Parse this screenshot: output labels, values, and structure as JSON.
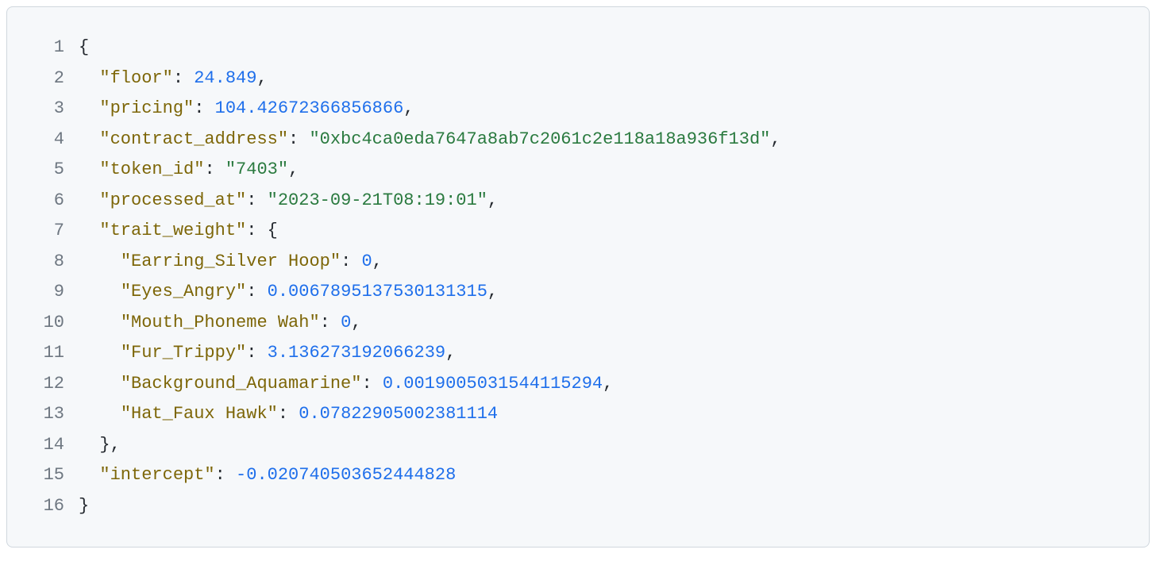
{
  "lines": [
    {
      "num": "1",
      "tokens": [
        {
          "t": "{",
          "c": "punct"
        }
      ]
    },
    {
      "num": "2",
      "tokens": [
        {
          "t": "  ",
          "c": "punct"
        },
        {
          "t": "\"floor\"",
          "c": "key"
        },
        {
          "t": ": ",
          "c": "punct"
        },
        {
          "t": "24.849",
          "c": "number"
        },
        {
          "t": ",",
          "c": "punct"
        }
      ]
    },
    {
      "num": "3",
      "tokens": [
        {
          "t": "  ",
          "c": "punct"
        },
        {
          "t": "\"pricing\"",
          "c": "key"
        },
        {
          "t": ": ",
          "c": "punct"
        },
        {
          "t": "104.42672366856866",
          "c": "number"
        },
        {
          "t": ",",
          "c": "punct"
        }
      ]
    },
    {
      "num": "4",
      "tokens": [
        {
          "t": "  ",
          "c": "punct"
        },
        {
          "t": "\"contract_address\"",
          "c": "key"
        },
        {
          "t": ": ",
          "c": "punct"
        },
        {
          "t": "\"0xbc4ca0eda7647a8ab7c2061c2e118a18a936f13d\"",
          "c": "string"
        },
        {
          "t": ",",
          "c": "punct"
        }
      ]
    },
    {
      "num": "5",
      "tokens": [
        {
          "t": "  ",
          "c": "punct"
        },
        {
          "t": "\"token_id\"",
          "c": "key"
        },
        {
          "t": ": ",
          "c": "punct"
        },
        {
          "t": "\"7403\"",
          "c": "string"
        },
        {
          "t": ",",
          "c": "punct"
        }
      ]
    },
    {
      "num": "6",
      "tokens": [
        {
          "t": "  ",
          "c": "punct"
        },
        {
          "t": "\"processed_at\"",
          "c": "key"
        },
        {
          "t": ": ",
          "c": "punct"
        },
        {
          "t": "\"2023-09-21T08:19:01\"",
          "c": "string"
        },
        {
          "t": ",",
          "c": "punct"
        }
      ]
    },
    {
      "num": "7",
      "tokens": [
        {
          "t": "  ",
          "c": "punct"
        },
        {
          "t": "\"trait_weight\"",
          "c": "key"
        },
        {
          "t": ": {",
          "c": "punct"
        }
      ]
    },
    {
      "num": "8",
      "tokens": [
        {
          "t": "    ",
          "c": "punct"
        },
        {
          "t": "\"Earring_Silver Hoop\"",
          "c": "key"
        },
        {
          "t": ": ",
          "c": "punct"
        },
        {
          "t": "0",
          "c": "number"
        },
        {
          "t": ",",
          "c": "punct"
        }
      ]
    },
    {
      "num": "9",
      "tokens": [
        {
          "t": "    ",
          "c": "punct"
        },
        {
          "t": "\"Eyes_Angry\"",
          "c": "key"
        },
        {
          "t": ": ",
          "c": "punct"
        },
        {
          "t": "0.0067895137530131315",
          "c": "number"
        },
        {
          "t": ",",
          "c": "punct"
        }
      ]
    },
    {
      "num": "10",
      "tokens": [
        {
          "t": "    ",
          "c": "punct"
        },
        {
          "t": "\"Mouth_Phoneme Wah\"",
          "c": "key"
        },
        {
          "t": ": ",
          "c": "punct"
        },
        {
          "t": "0",
          "c": "number"
        },
        {
          "t": ",",
          "c": "punct"
        }
      ]
    },
    {
      "num": "11",
      "tokens": [
        {
          "t": "    ",
          "c": "punct"
        },
        {
          "t": "\"Fur_Trippy\"",
          "c": "key"
        },
        {
          "t": ": ",
          "c": "punct"
        },
        {
          "t": "3.136273192066239",
          "c": "number"
        },
        {
          "t": ",",
          "c": "punct"
        }
      ]
    },
    {
      "num": "12",
      "tokens": [
        {
          "t": "    ",
          "c": "punct"
        },
        {
          "t": "\"Background_Aquamarine\"",
          "c": "key"
        },
        {
          "t": ": ",
          "c": "punct"
        },
        {
          "t": "0.0019005031544115294",
          "c": "number"
        },
        {
          "t": ",",
          "c": "punct"
        }
      ]
    },
    {
      "num": "13",
      "tokens": [
        {
          "t": "    ",
          "c": "punct"
        },
        {
          "t": "\"Hat_Faux Hawk\"",
          "c": "key"
        },
        {
          "t": ": ",
          "c": "punct"
        },
        {
          "t": "0.07822905002381114",
          "c": "number"
        }
      ]
    },
    {
      "num": "14",
      "tokens": [
        {
          "t": "  },",
          "c": "punct"
        }
      ]
    },
    {
      "num": "15",
      "tokens": [
        {
          "t": "  ",
          "c": "punct"
        },
        {
          "t": "\"intercept\"",
          "c": "key"
        },
        {
          "t": ": ",
          "c": "punct"
        },
        {
          "t": "-0.020740503652444828",
          "c": "number"
        }
      ]
    },
    {
      "num": "16",
      "tokens": [
        {
          "t": "}",
          "c": "punct"
        }
      ]
    }
  ]
}
